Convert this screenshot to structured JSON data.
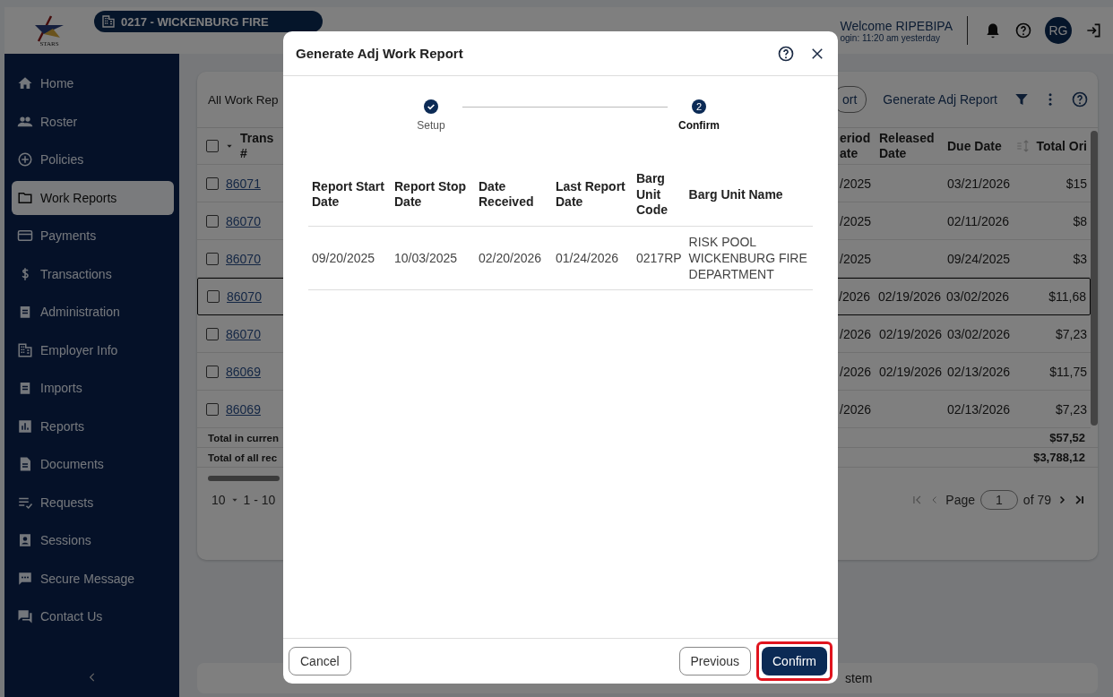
{
  "header": {
    "logo_text": "STARS",
    "org": "0217 - WICKENBURG FIRE",
    "welcome": "Welcome RIPEBIPA",
    "last_login": "ogin: 11:20 am yesterday",
    "avatar": "RG"
  },
  "sidebar": {
    "items": [
      {
        "label": "Home",
        "selected": false
      },
      {
        "label": "Roster",
        "selected": false
      },
      {
        "label": "Policies",
        "selected": false
      },
      {
        "label": "Work Reports",
        "selected": true
      },
      {
        "label": "Payments",
        "selected": false
      },
      {
        "label": "Transactions",
        "selected": false
      },
      {
        "label": "Administration",
        "selected": false
      },
      {
        "label": "Employer Info",
        "selected": false
      },
      {
        "label": "Imports",
        "selected": false
      },
      {
        "label": "Reports",
        "selected": false
      },
      {
        "label": "Documents",
        "selected": false
      },
      {
        "label": "Requests",
        "selected": false
      },
      {
        "label": "Sessions",
        "selected": false
      },
      {
        "label": "Secure Message",
        "selected": false
      },
      {
        "label": "Contact Us",
        "selected": false
      }
    ]
  },
  "card": {
    "title": "All Work Rep",
    "actions": [
      {
        "label": "ort",
        "kind": "outlined"
      },
      {
        "label": "Generate Adj Report",
        "kind": "text"
      }
    ],
    "trans_column": "Trans #",
    "select_all_checked": false,
    "columns": [
      "eriod ate",
      "Released Date",
      "Due Date",
      "Total Ori"
    ],
    "rows": [
      {
        "trans": "86071",
        "period": "/2025",
        "due": "03/21/2026",
        "total": "$15",
        "focused": false,
        "checked": false
      },
      {
        "trans": "86070",
        "period": "/2025",
        "due": "02/11/2026",
        "total": "$8",
        "focused": false,
        "checked": false
      },
      {
        "trans": "86070",
        "period": "/2025",
        "due": "09/24/2025",
        "total": "$3",
        "focused": false,
        "checked": false
      },
      {
        "trans": "86070",
        "period": "/2026",
        "released": "02/19/2026",
        "due": "03/02/2026",
        "total": "$11,68",
        "focused": true,
        "checked": false
      },
      {
        "trans": "86070",
        "period": "/2026",
        "released": "02/19/2026",
        "due": "03/02/2026",
        "total": "$7,23",
        "focused": false,
        "checked": false
      },
      {
        "trans": "86069",
        "period": "/2026",
        "released": "02/19/2026",
        "due": "02/13/2026",
        "total": "$11,75",
        "focused": false,
        "checked": false
      },
      {
        "trans": "86069",
        "period": "/2026",
        "due": "02/13/2026",
        "total": "$7,23",
        "focused": false,
        "checked": false
      }
    ],
    "totals": [
      {
        "label": "Total in curren",
        "value": "$57,52"
      },
      {
        "label": "Total of all rec",
        "value": "$3,788,12"
      }
    ],
    "pagination": {
      "page_size": "10",
      "range": "1 - 10",
      "page_label": "Page",
      "page": "1",
      "of": "of 79"
    }
  },
  "footer": {
    "text": "stem"
  },
  "modal": {
    "title": "Generate Adj Work Report",
    "steps": [
      {
        "label": "Setup",
        "done": true,
        "selected": false
      },
      {
        "label": "Confirm",
        "number": "2",
        "done": false,
        "selected": true
      }
    ],
    "columns": [
      "Report Start Date",
      "Report Stop Date",
      "Date Received",
      "Last Report Date",
      "Barg Unit Code",
      "Barg Unit Name"
    ],
    "rows": [
      [
        "09/20/2025",
        "10/03/2025",
        "02/20/2026",
        "01/24/2026",
        "0217RP",
        "RISK POOL WICKENBURG FIRE DEPARTMENT"
      ]
    ],
    "buttons": [
      {
        "label": "Cancel",
        "kind": "outlined",
        "highlighted": false
      },
      {
        "label": "Previous",
        "kind": "outlined",
        "highlighted": false
      },
      {
        "label": "Confirm",
        "kind": "primary",
        "highlighted": true
      }
    ]
  }
}
